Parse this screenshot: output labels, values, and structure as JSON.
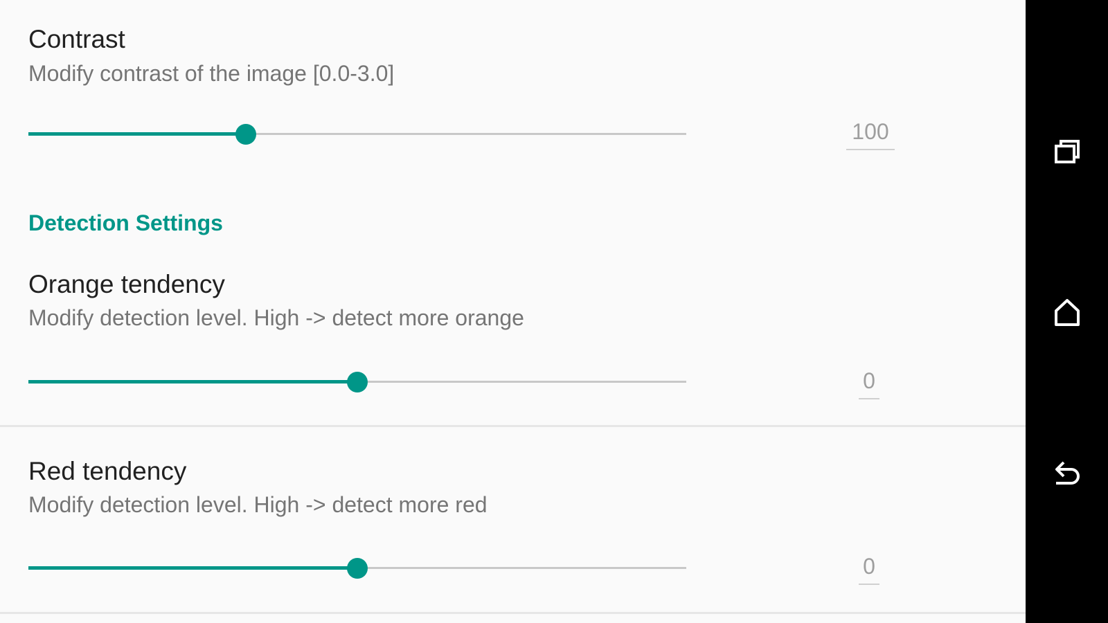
{
  "prefs": {
    "contrast": {
      "title": "Contrast",
      "summary": "Modify contrast of the image [0.0-3.0]",
      "value": "100",
      "slider_fraction": 0.33
    },
    "section": {
      "title": "Detection Settings"
    },
    "orange": {
      "title": "Orange tendency",
      "summary": "Modify detection level. High -> detect more orange",
      "value": "0",
      "slider_fraction": 0.5
    },
    "red": {
      "title": "Red tendency",
      "summary": "Modify detection level. High -> detect more red",
      "value": "0",
      "slider_fraction": 0.5
    }
  },
  "navbar": {
    "icons": [
      "recent-apps-icon",
      "home-icon",
      "back-icon"
    ]
  },
  "colors": {
    "accent": "#009688",
    "background": "#fafafa",
    "navbar": "#000000"
  }
}
